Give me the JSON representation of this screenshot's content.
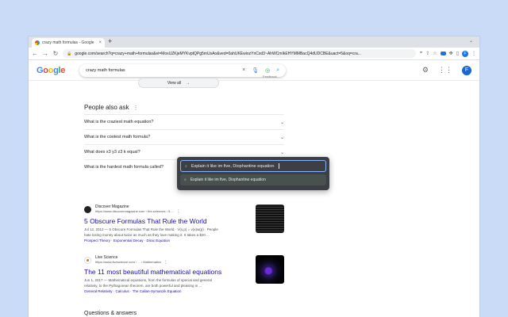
{
  "browser": {
    "tab_title": "crazy math formulas - Google",
    "tab_close": "×",
    "new_tab": "+",
    "url": "google.com/search?q=crazy+math+formulas&ei=MoxUZKjeMYKvptQPg5mUsAo&ved=0ahUKEwiozYnCxd3~AhWCmIkEHYMMBacQ4dUDCBE&uact=5&oq=cra...",
    "profile_initial": "F"
  },
  "google": {
    "logo_letters": [
      "G",
      "o",
      "o",
      "g",
      "l",
      "e"
    ],
    "query": "crazy math formulas",
    "clear": "×",
    "avatar_initial": "F"
  },
  "top": {
    "view_all": "View all",
    "view_all_arrow": "→",
    "feedback": "Feedback"
  },
  "paa": {
    "title": "People also ask",
    "kebab": "⋮",
    "chevron": "⌄",
    "questions": [
      "What is the craziest math equation?",
      "What is the coolest math formula?",
      "What does x3 y3 z3 k equal?",
      "What is the hardest math formula called?"
    ],
    "feedback": "Feedback"
  },
  "overlay": {
    "input_value": "Explain it like im five, Diophantine equation",
    "suggestion": "Explain it like im five, Diophantine equation"
  },
  "results": [
    {
      "site_name": "Discover Magazine",
      "url": "https://www.discovermagazine.com › the-sciences › 5-...",
      "title": "5 Obscure Formulas That Rule the World",
      "snippet_date": "Jul 12, 2012 —",
      "snippet_line1": "5 Obscure Formulas That Rule the World · V(x,p) = v(x)w(p) · People",
      "snippet_line2": "hate losing money about twice as much as they love making it. It takes a $20 ...",
      "links": "Prospect Theory · Exponential Decay · Dirac Equation"
    },
    {
      "site_name": "Live Science",
      "url": "https://www.livescience.com › ... › Mathematics",
      "title": "The 11 most beautiful mathematical equations",
      "snippet_date": "Jun 1, 2017 —",
      "snippet_line1": "Mathematical equations, from the formulas of special and general",
      "snippet_line2": "relativity, to the Pythagorean theorem, are both powerful and pleasing in ...",
      "links": "General Relativity · Calculus · The Callan-Symanzik Equation"
    }
  ],
  "more_heading": "Questions & answers",
  "colors": {
    "background": "#c9dbf7",
    "link": "#1a0dab",
    "accent": "#1a73e8",
    "overlay": "#3c3f45"
  }
}
